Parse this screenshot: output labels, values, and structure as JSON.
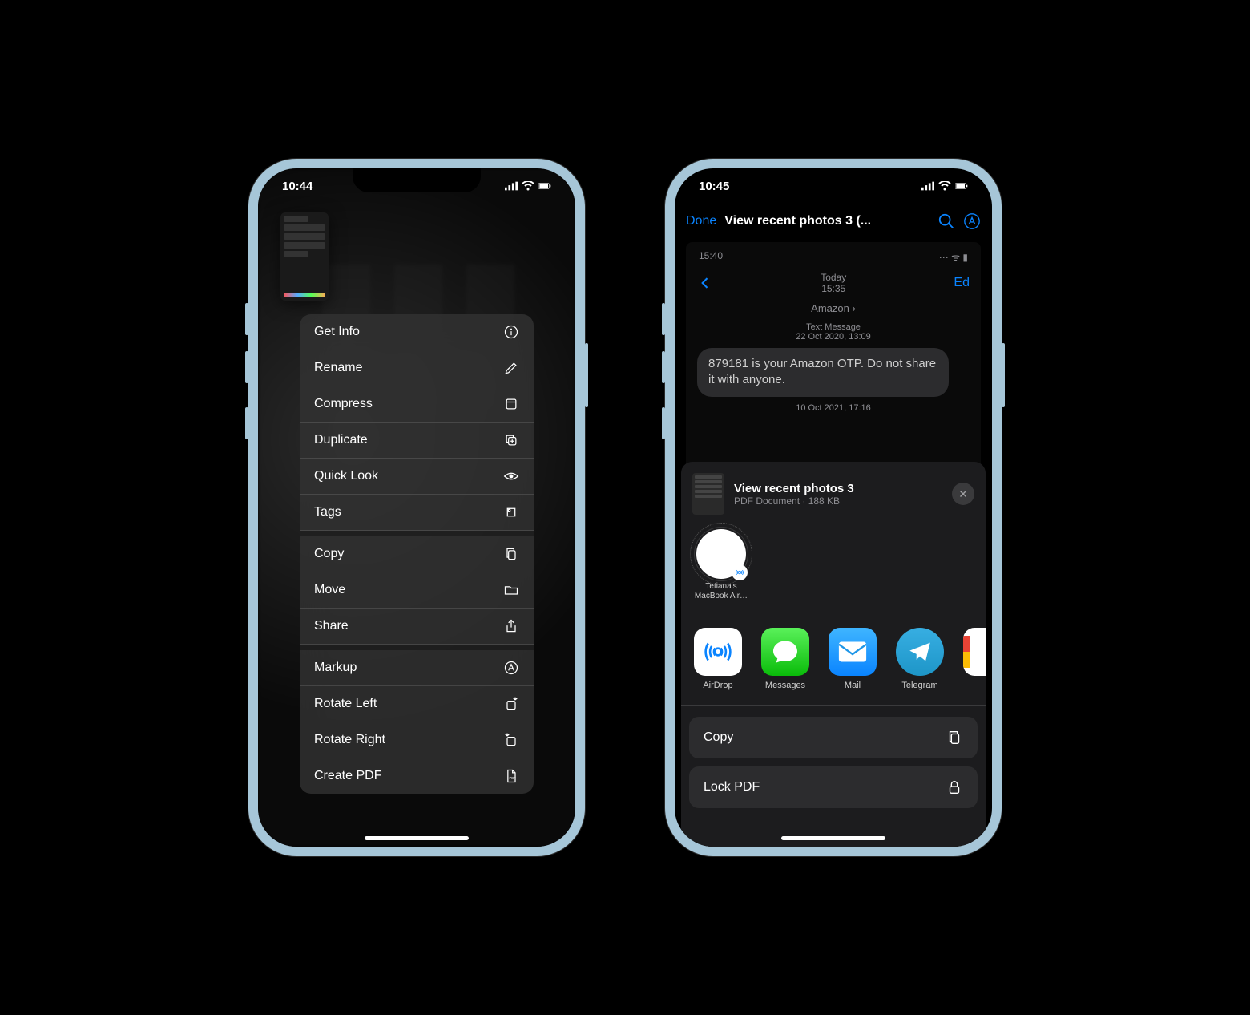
{
  "phone1": {
    "status_time": "10:44",
    "menu": {
      "group1": [
        {
          "label": "Get Info",
          "icon": "info-icon"
        },
        {
          "label": "Rename",
          "icon": "pencil-icon"
        },
        {
          "label": "Compress",
          "icon": "archive-icon"
        },
        {
          "label": "Duplicate",
          "icon": "duplicate-icon"
        },
        {
          "label": "Quick Look",
          "icon": "eye-icon"
        },
        {
          "label": "Tags",
          "icon": "tag-icon"
        }
      ],
      "group2": [
        {
          "label": "Copy",
          "icon": "copy-icon"
        },
        {
          "label": "Move",
          "icon": "folder-icon"
        },
        {
          "label": "Share",
          "icon": "share-icon"
        }
      ],
      "group3": [
        {
          "label": "Markup",
          "icon": "markup-icon"
        },
        {
          "label": "Rotate Left",
          "icon": "rotate-left-icon"
        },
        {
          "label": "Rotate Right",
          "icon": "rotate-right-icon"
        },
        {
          "label": "Create PDF",
          "icon": "pdf-icon"
        }
      ]
    }
  },
  "phone2": {
    "status_time": "10:45",
    "nav_done": "Done",
    "nav_title": "View recent photos 3 (...",
    "doc_inner_time": "15:40",
    "doc_today": "Today",
    "doc_today_time": "15:35",
    "doc_edit": "Ed",
    "doc_contact": "Amazon ›",
    "doc_msg_meta1": "Text Message",
    "doc_msg_meta2": "22 Oct 2020, 13:09",
    "doc_msg": "879181 is your Amazon OTP. Do not share it with anyone.",
    "doc_msg_date2": "10 Oct 2021, 17:16",
    "share": {
      "title": "View recent photos 3",
      "subtitle": "PDF Document · 188 KB",
      "airdrop_target": "Tetiana's MacBook Air…",
      "apps": [
        {
          "label": "AirDrop",
          "key": "airdrop"
        },
        {
          "label": "Messages",
          "key": "messages"
        },
        {
          "label": "Mail",
          "key": "mail"
        },
        {
          "label": "Telegram",
          "key": "telegram"
        }
      ],
      "actions": [
        {
          "label": "Copy",
          "icon": "copy-icon"
        },
        {
          "label": "Lock PDF",
          "icon": "lock-icon"
        }
      ]
    }
  }
}
